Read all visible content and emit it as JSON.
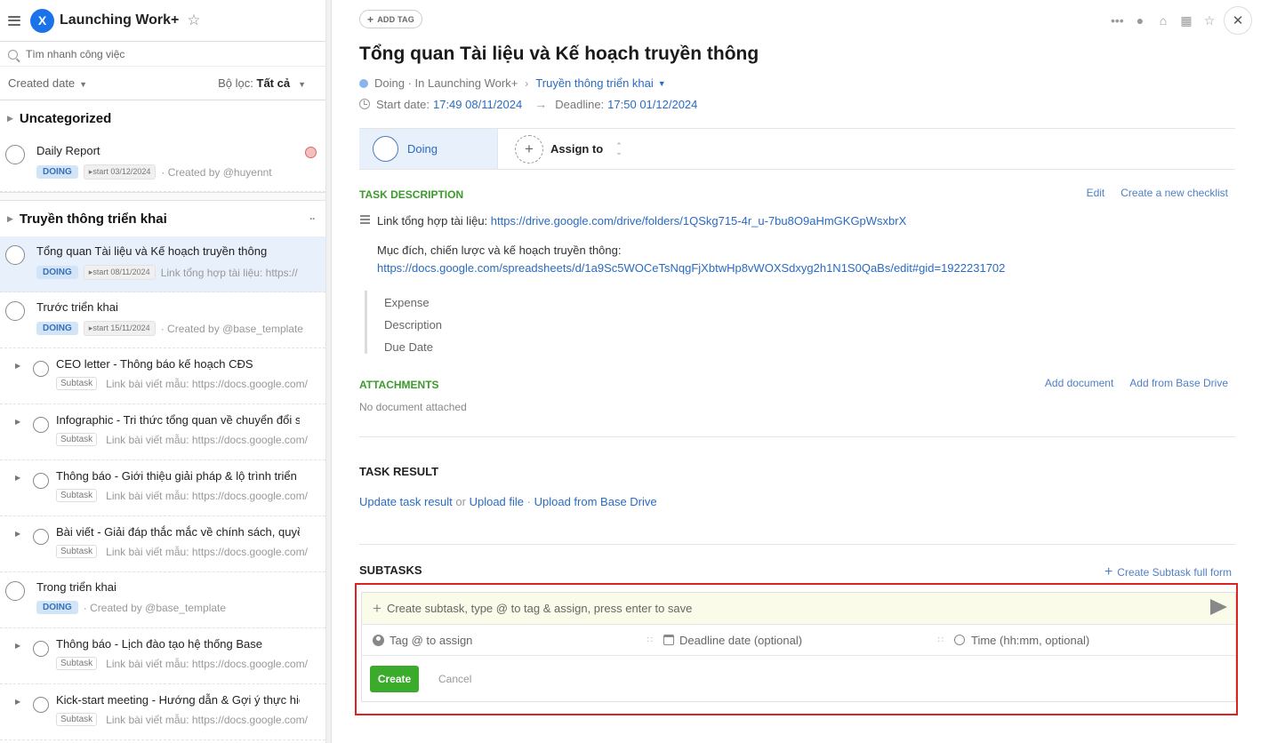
{
  "sidebar": {
    "app_logo_letter": "X",
    "app_title": "Launching Work+",
    "search_placeholder": "Tìm nhanh công việc",
    "sort_label": "Created date",
    "filter_label": "Bộ lọc:",
    "filter_value": "Tất cả",
    "groups": [
      {
        "name": "Uncategorized",
        "tasks": [
          {
            "title": "Daily Report",
            "status": "DOING",
            "start": "start 03/12/2024",
            "extra": "· Created by @huyennt"
          }
        ]
      },
      {
        "name": "Truyền thông triển khai",
        "more": "··",
        "tasks": [
          {
            "title": "Tổng quan Tài liệu và Kế hoạch truyền thông",
            "status": "DOING",
            "start": "start 08/11/2024",
            "extra": "Link tổng hợp tài liệu: https://"
          },
          {
            "title": "Trước triển khai",
            "status": "DOING",
            "start": "start 15/11/2024",
            "extra": "· Created by @base_template"
          }
        ],
        "subtasks_1": [
          {
            "title": "CEO letter - Thông báo kế hoạch CĐS",
            "badge": "Subtask",
            "extra": "Link bài viết mẫu: https://docs.google.com/"
          },
          {
            "title": "Infographic - Tri thức tổng quan về chuyển đổi s",
            "badge": "Subtask",
            "extra": "Link bài viết mẫu: https://docs.google.com/"
          },
          {
            "title": "Thông báo - Giới thiệu giải pháp & lộ trình triển k",
            "badge": "Subtask",
            "extra": "Link bài viết mẫu: https://docs.google.com/"
          },
          {
            "title": "Bài viết - Giải đáp thắc mắc về chính sách, quyề",
            "badge": "Subtask",
            "extra": "Link bài viết mẫu: https://docs.google.com/"
          }
        ],
        "task_3": {
          "title": "Trong triển khai",
          "status": "DOING",
          "extra": "· Created by @base_template"
        },
        "subtasks_2": [
          {
            "title": "Thông báo - Lịch đào tạo hệ thống Base",
            "badge": "Subtask",
            "extra": "Link bài viết mẫu: https://docs.google.com/"
          },
          {
            "title": "Kick-start meeting - Hướng dẫn & Gợi ý thực hiệ",
            "badge": "Subtask",
            "extra": "Link bài viết mẫu: https://docs.google.com/"
          }
        ]
      }
    ]
  },
  "main": {
    "add_tag_label": "ADD TAG",
    "title": "Tổng quan Tài liệu và Kế hoạch truyền thông",
    "breadcrumb": {
      "status": "Doing",
      "project": "· In Launching Work+",
      "sep": "›",
      "group": "Truyền thông triển khai"
    },
    "dates": {
      "start_label": "Start date:",
      "start_value": "17:49 08/11/2024",
      "deadline_label": "Deadline:",
      "deadline_value": "17:50 01/12/2024"
    },
    "status_cell": "Doing",
    "assign_label": "Assign to",
    "description": {
      "heading": "TASK DESCRIPTION",
      "edit": "Edit",
      "create_checklist": "Create a new checklist",
      "line1_text": "Link tổng hợp tài liệu:",
      "line1_link": "https://drive.google.com/drive/folders/1QSkg715-4r_u-7bu8O9aHmGKGpWsxbrX",
      "line2_text": "Mục đích, chiến lược và kế hoạch truyền thông:",
      "line2_link": "https://docs.google.com/spreadsheets/d/1a9Sc5WOCeTsNqgFjXbtwHp8vWOXSdxyg2h1N1S0QaBs/edit#gid=1922231702",
      "quote_lines": [
        "Expense",
        "Description",
        "Due Date"
      ]
    },
    "attachments": {
      "heading": "ATTACHMENTS",
      "add_document": "Add document",
      "add_from_drive": "Add from Base Drive",
      "empty": "No document attached"
    },
    "task_result": {
      "heading": "TASK RESULT",
      "update": "Update task result",
      "or": "or",
      "upload": "Upload file",
      "dot": "·",
      "upload_drive": "Upload from Base Drive"
    },
    "subtasks": {
      "heading": "SUBTASKS",
      "create_full": "Create Subtask full form",
      "input_placeholder": "Create subtask, type @ to tag & assign, press enter to save",
      "assign_placeholder": "Tag @ to assign",
      "deadline_placeholder": "Deadline date (optional)",
      "time_placeholder": "Time (hh:mm, optional)",
      "create_btn": "Create",
      "cancel_btn": "Cancel"
    }
  },
  "colors": {
    "accent": "#2a6bc2",
    "green": "#3bab2b",
    "highlight_border": "#dd2222"
  }
}
